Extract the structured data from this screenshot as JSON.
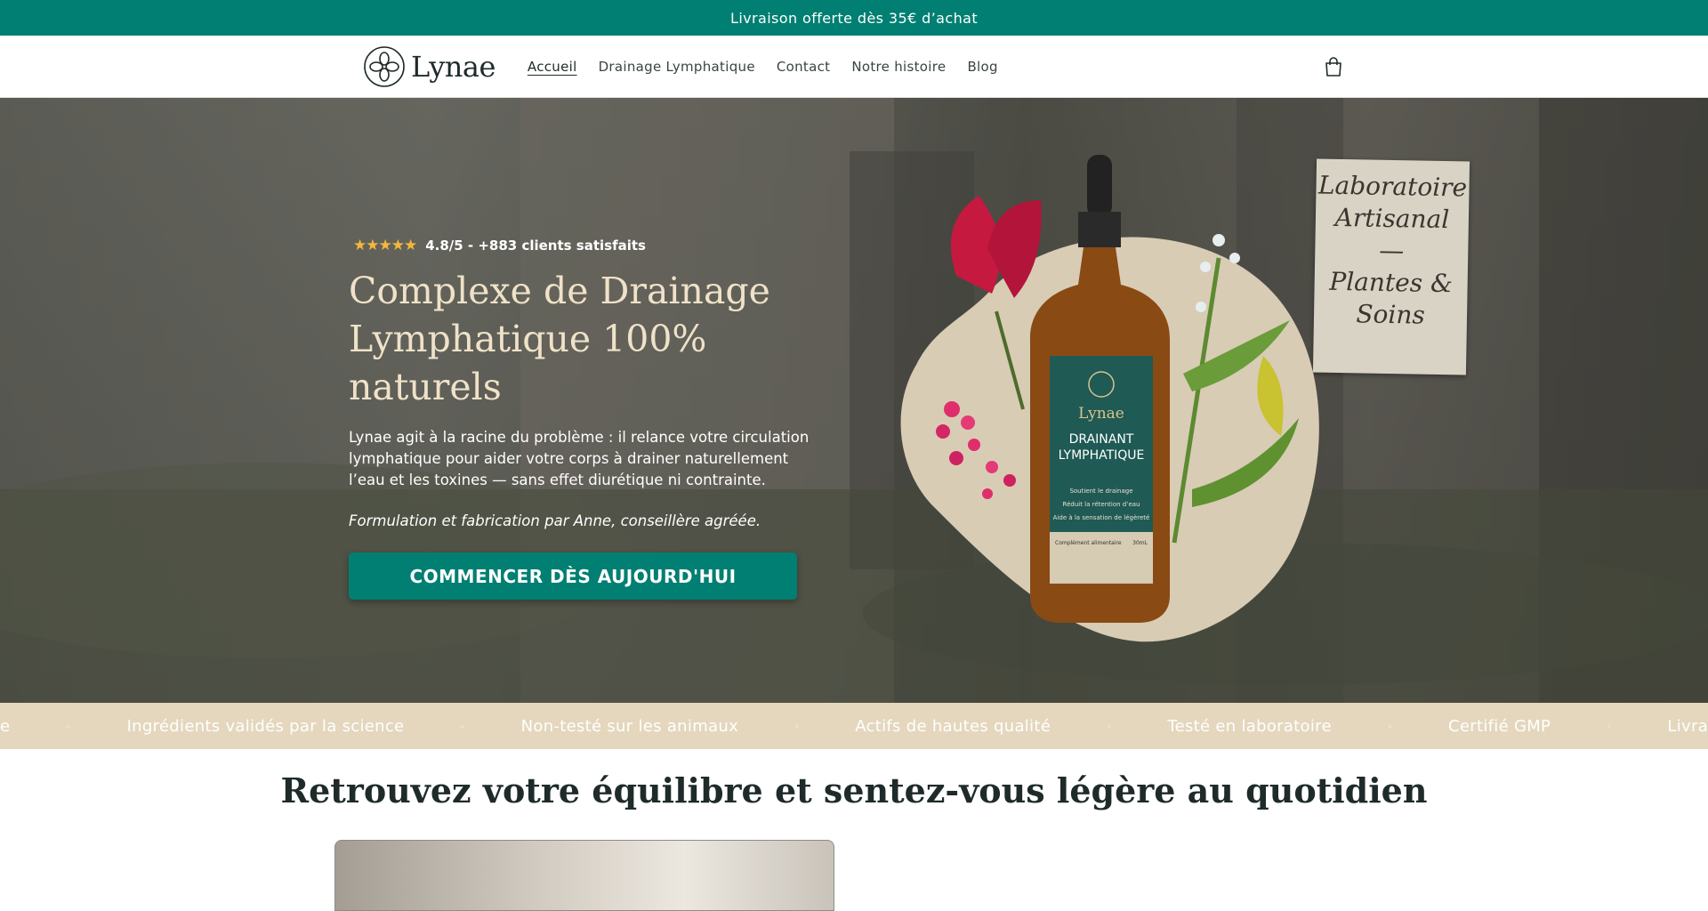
{
  "announcement": "Livraison offerte dès 35€ d’achat",
  "brand": {
    "name": "Lynae"
  },
  "nav": {
    "items": [
      {
        "label": "Accueil",
        "active": true
      },
      {
        "label": "Drainage Lymphatique",
        "active": false
      },
      {
        "label": "Contact",
        "active": false
      },
      {
        "label": "Notre histoire",
        "active": false
      },
      {
        "label": "Blog",
        "active": false
      }
    ]
  },
  "hero": {
    "rating_text": "4.8/5 - +883 clients satisfaits",
    "stars": 5,
    "title": "Complexe de Drainage Lymphatique 100% naturels",
    "description": "Lynae agit à la racine du problème : il relance votre circulation lymphatique pour aider votre corps à drainer naturellement l’eau et les toxines — sans effet diurétique ni contrainte.",
    "signature": "Formulation et fabrication par Anne, conseillère agréée.",
    "cta": "COMMENCER DÈS AUJOURD'HUI"
  },
  "product": {
    "label_brand": "Lynae",
    "label_line1": "DRAINANT",
    "label_line2": "LYMPHATIQUE",
    "benefits": [
      "Soutient le drainage",
      "Réduit la rétention d’eau",
      "Aide à la sensation de légèreté"
    ],
    "footer_left": "Complément alimentaire",
    "footer_right": "30mL"
  },
  "sign": {
    "lines": [
      "Laboratoire",
      "Artisanal",
      "—",
      "Plantes &",
      "Soins"
    ]
  },
  "marquee": {
    "items": [
      "e",
      "Ingrédients validés par la science",
      "Non-testé sur les animaux",
      "Actifs de hautes qualité",
      "Testé en laboratoire",
      "Certifié GMP",
      "Livra"
    ]
  },
  "section": {
    "title_before": "Retrouvez votre",
    "title_bold": "équilibre",
    "title_after": "et sentez-vous légère au quotidien"
  },
  "colors": {
    "brand": "#017f72",
    "cream": "#e4d7bd",
    "title_cream": "#efe2c8",
    "star": "#f4b73b"
  }
}
